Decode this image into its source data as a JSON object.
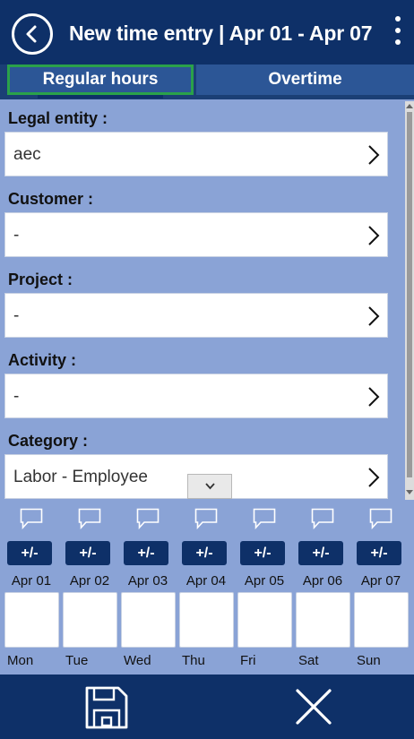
{
  "header": {
    "title": "New time entry | Apr 01 - Apr 07"
  },
  "tabs": [
    {
      "label": "Regular hours"
    },
    {
      "label": "Overtime"
    }
  ],
  "fields": [
    {
      "label": "Legal entity :",
      "value": "aec"
    },
    {
      "label": "Customer :",
      "value": "-"
    },
    {
      "label": "Project :",
      "value": "-"
    },
    {
      "label": "Activity :",
      "value": "-"
    },
    {
      "label": "Category :",
      "value": "Labor - Employee"
    }
  ],
  "adjust_label": "+/-",
  "days": [
    {
      "date": "Apr 01",
      "dow": "Mon"
    },
    {
      "date": "Apr 02",
      "dow": "Tue"
    },
    {
      "date": "Apr 03",
      "dow": "Wed"
    },
    {
      "date": "Apr 04",
      "dow": "Thu"
    },
    {
      "date": "Apr 05",
      "dow": "Fri"
    },
    {
      "date": "Apr 06",
      "dow": "Sat"
    },
    {
      "date": "Apr 07",
      "dow": "Sun"
    }
  ],
  "colors": {
    "header": "#0e3068",
    "background": "#8aa3d6",
    "selected_tab_outline": "#2aa14a"
  },
  "icons": [
    "back-arrow-icon",
    "more-vertical-icon",
    "chevron-right-icon",
    "chevron-down-icon",
    "comment-icon",
    "save-icon",
    "close-icon"
  ]
}
